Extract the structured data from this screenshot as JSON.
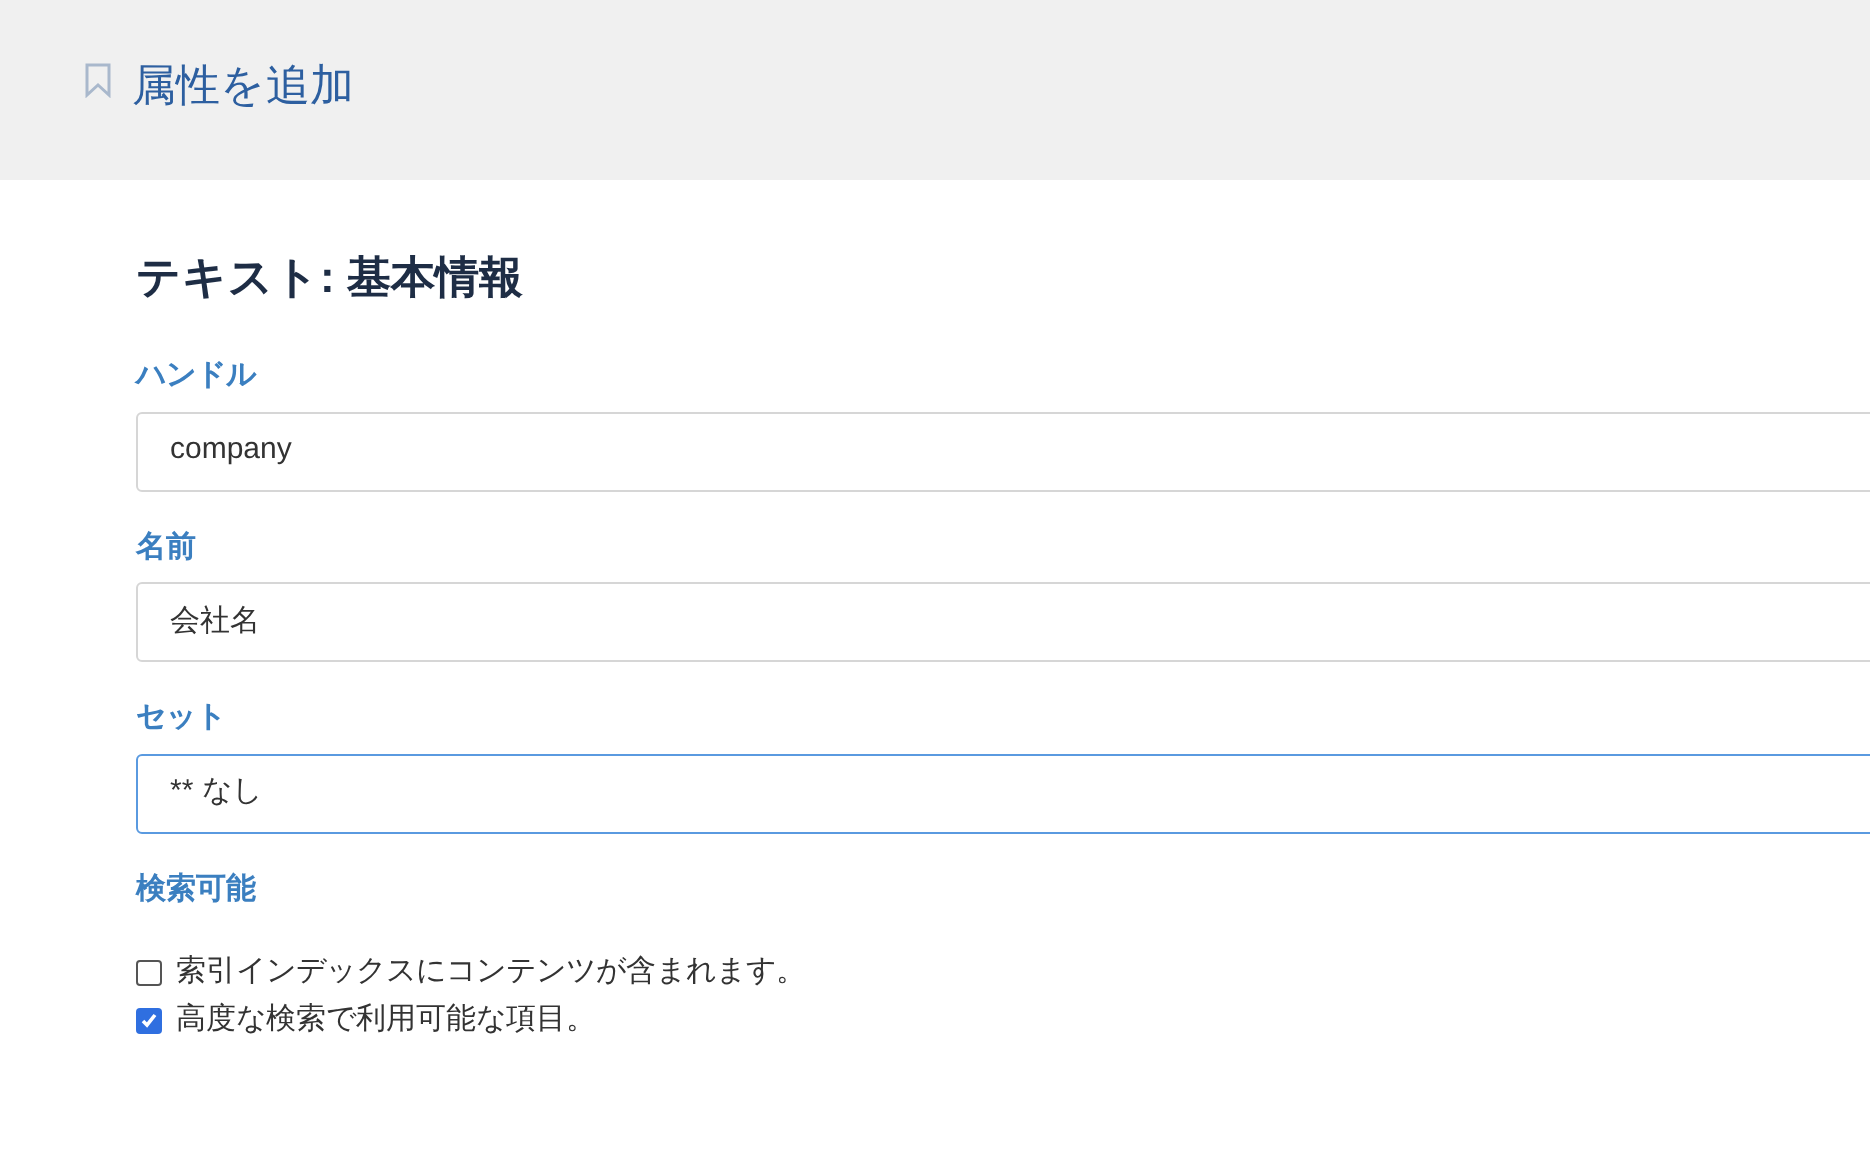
{
  "header": {
    "title": "属性を追加"
  },
  "section": {
    "title": "テキスト: 基本情報"
  },
  "fields": [
    {
      "label": "ハンドル",
      "value": "company",
      "focused": false
    },
    {
      "label": "名前",
      "value": "会社名",
      "focused": false
    },
    {
      "label": "セット",
      "value": "** なし",
      "focused": true
    }
  ],
  "searchable": {
    "label": "検索可能",
    "options": [
      {
        "label": "索引インデックスにコンテンツが含まれます。",
        "checked": false
      },
      {
        "label": "高度な検索で利用可能な項目。",
        "checked": true
      }
    ]
  }
}
